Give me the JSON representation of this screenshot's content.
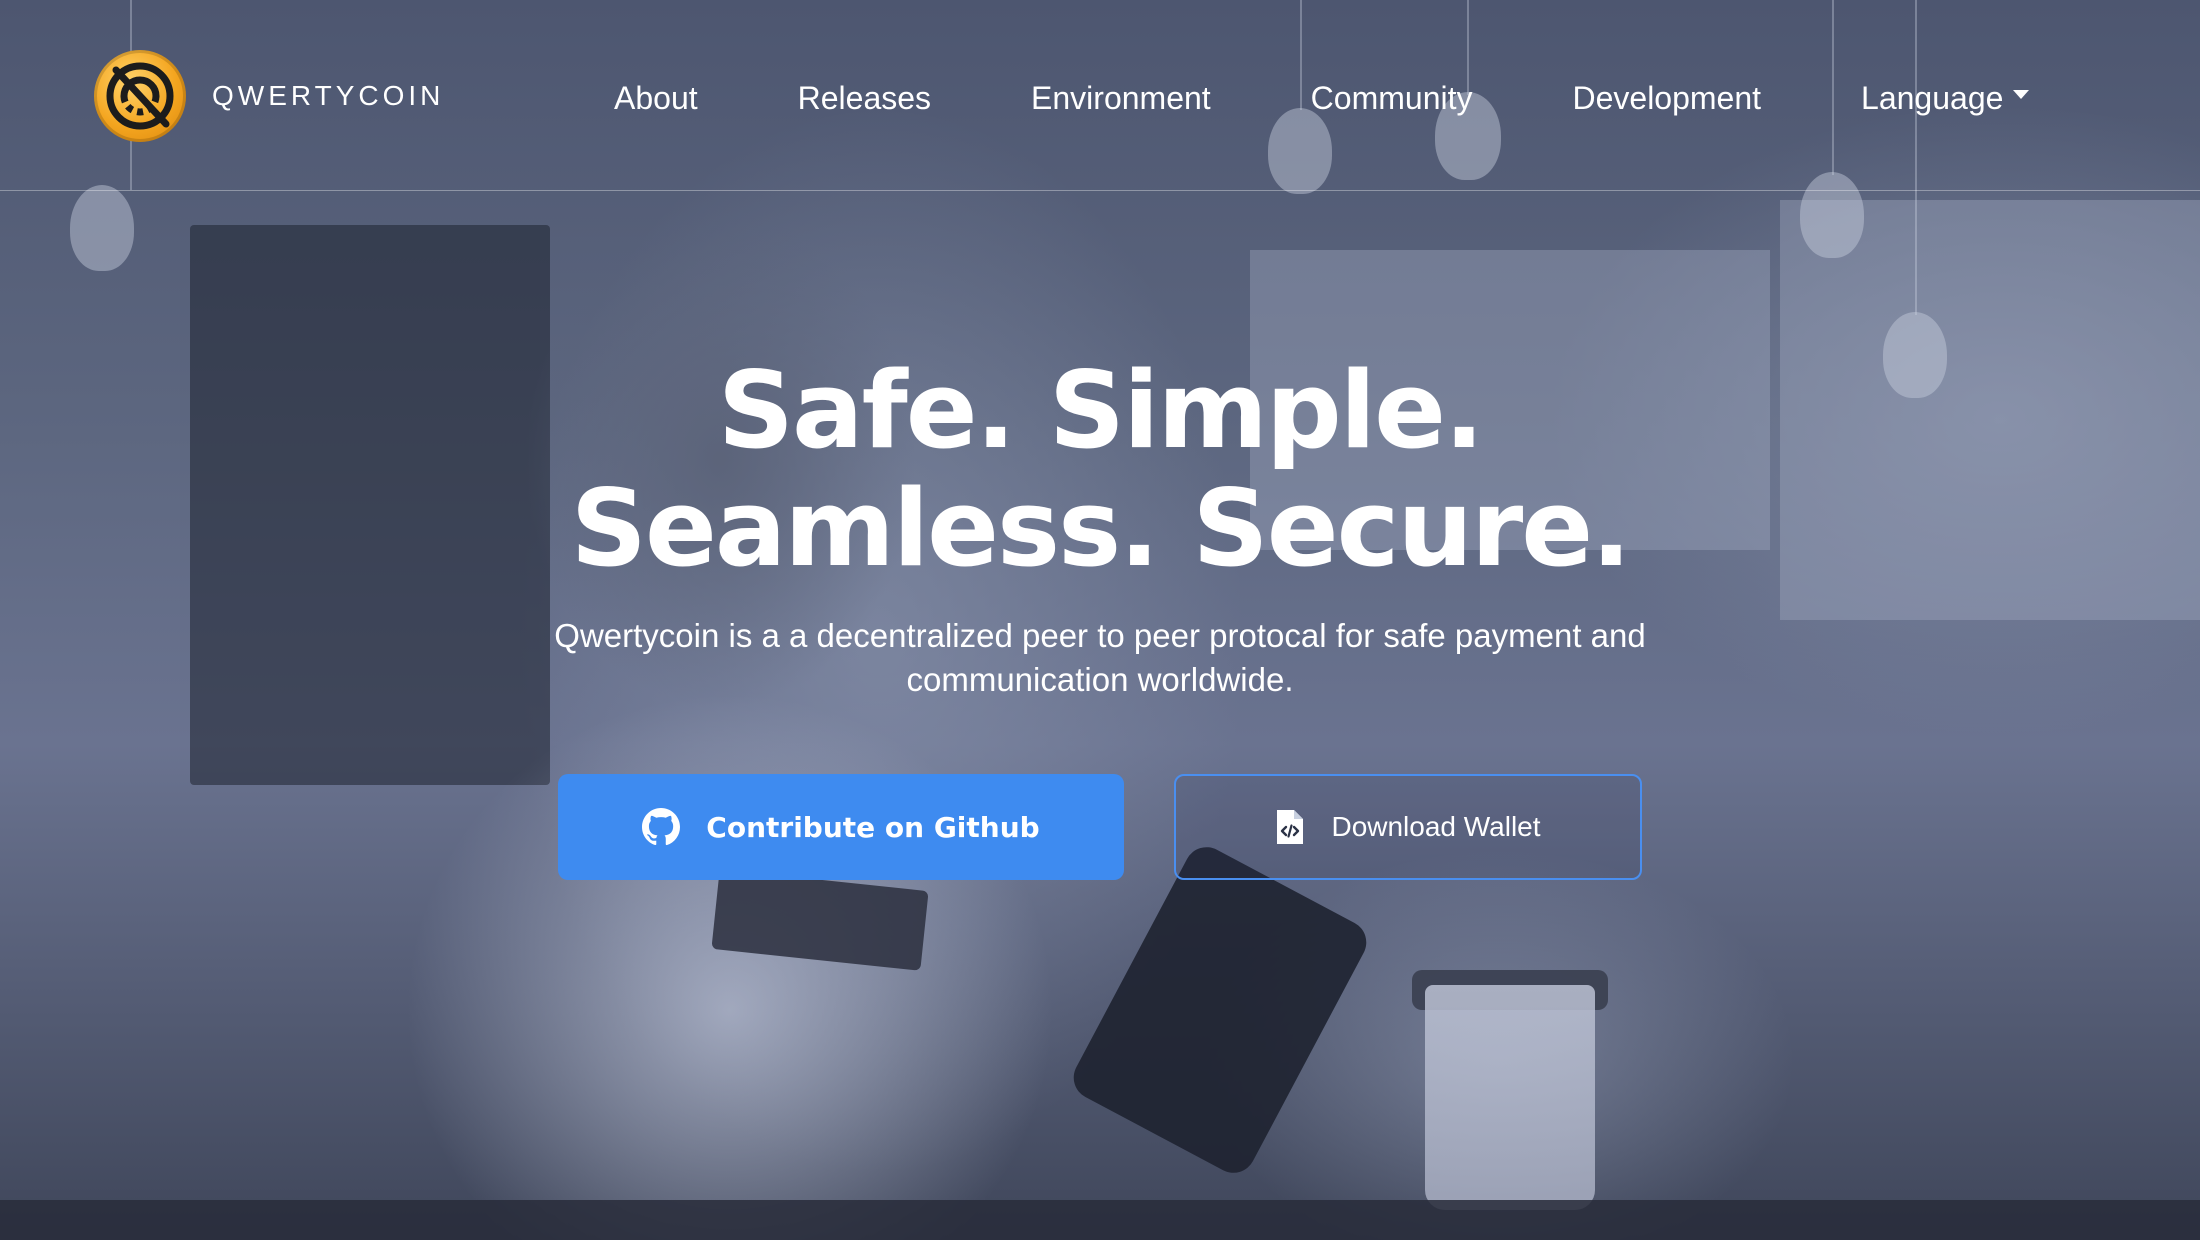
{
  "brand": {
    "name": "QWERTYCOIN",
    "logo_icon": "qwertycoin-logo-icon",
    "logo_color": "#f4a51f"
  },
  "nav": {
    "items": [
      {
        "label": "About"
      },
      {
        "label": "Releases"
      },
      {
        "label": "Environment"
      },
      {
        "label": "Community"
      },
      {
        "label": "Development"
      },
      {
        "label": "Language"
      }
    ],
    "language_icon": "caret-down-icon"
  },
  "hero": {
    "headline_line1": "Safe. Simple.",
    "headline_line2": "Seamless. Secure.",
    "subhead": "Qwertycoin is a a decentralized peer to peer protocal for safe payment and communication worldwide.",
    "primary_button": {
      "label": "Contribute on Github",
      "icon": "github-icon",
      "color": "#3e8bf0"
    },
    "secondary_button": {
      "label": "Download Wallet",
      "icon": "code-file-icon",
      "border_color": "#4a8ff0"
    }
  }
}
